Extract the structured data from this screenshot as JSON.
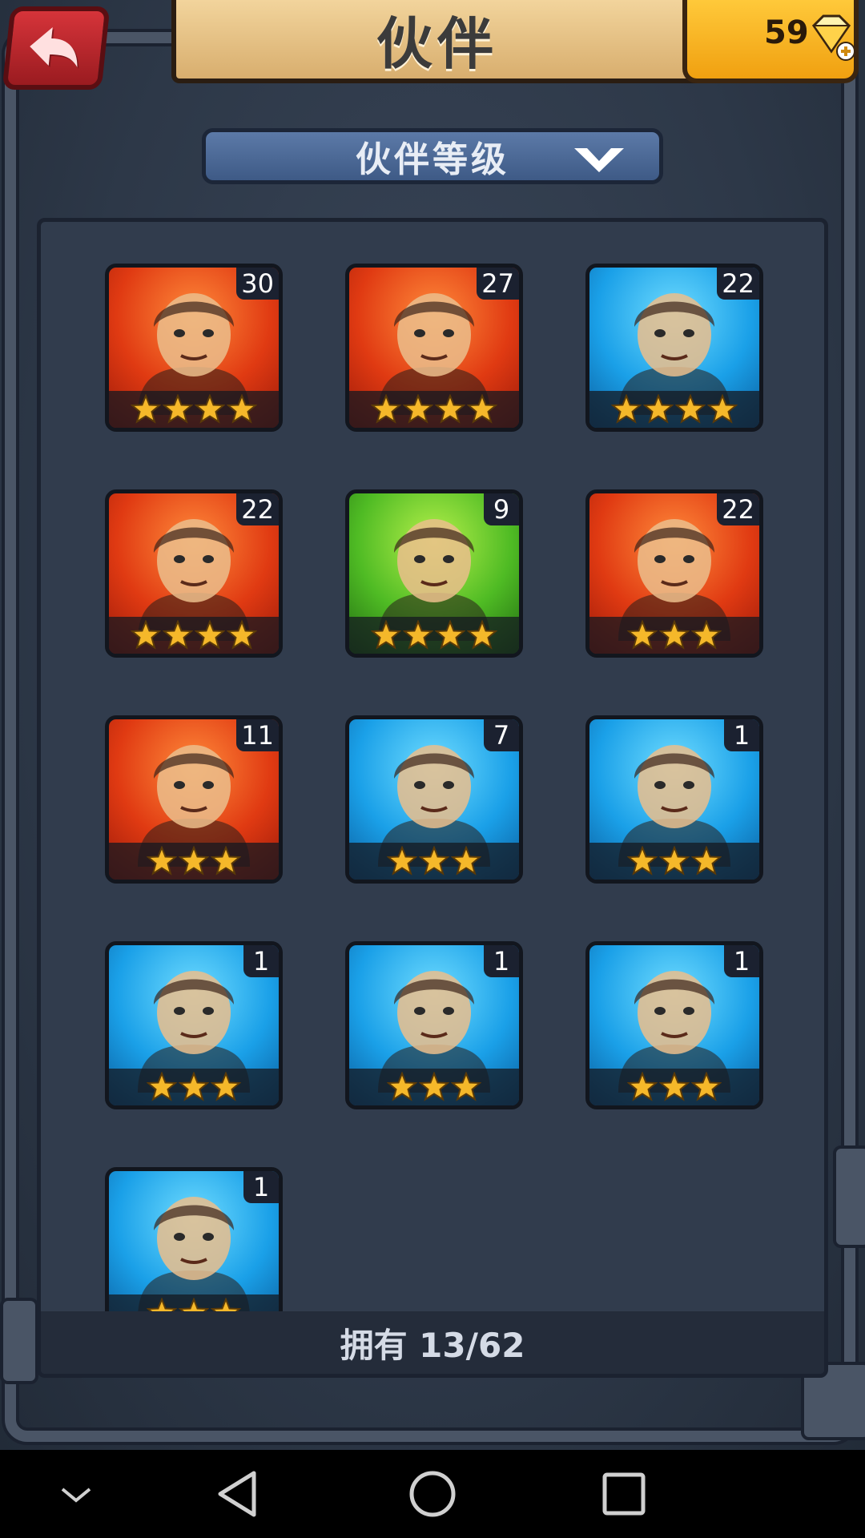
{
  "header": {
    "title": "伙伴",
    "gems": "59"
  },
  "sort": {
    "label": "伙伴等级"
  },
  "companions": [
    {
      "level": "30",
      "stars": 4,
      "bg": "red"
    },
    {
      "level": "27",
      "stars": 4,
      "bg": "red"
    },
    {
      "level": "22",
      "stars": 4,
      "bg": "blue"
    },
    {
      "level": "22",
      "stars": 4,
      "bg": "red"
    },
    {
      "level": "9",
      "stars": 4,
      "bg": "green"
    },
    {
      "level": "22",
      "stars": 3,
      "bg": "red"
    },
    {
      "level": "11",
      "stars": 3,
      "bg": "red"
    },
    {
      "level": "7",
      "stars": 3,
      "bg": "blue"
    },
    {
      "level": "1",
      "stars": 3,
      "bg": "blue"
    },
    {
      "level": "1",
      "stars": 3,
      "bg": "blue"
    },
    {
      "level": "1",
      "stars": 3,
      "bg": "blue"
    },
    {
      "level": "1",
      "stars": 3,
      "bg": "blue"
    },
    {
      "level": "1",
      "stars": 3,
      "bg": "blue"
    }
  ],
  "footer": {
    "owned": "拥有 13/62"
  },
  "colors": {
    "star": "#f5b82a",
    "accent_gold": "#ffc93a",
    "back_red": "#d6343a"
  }
}
